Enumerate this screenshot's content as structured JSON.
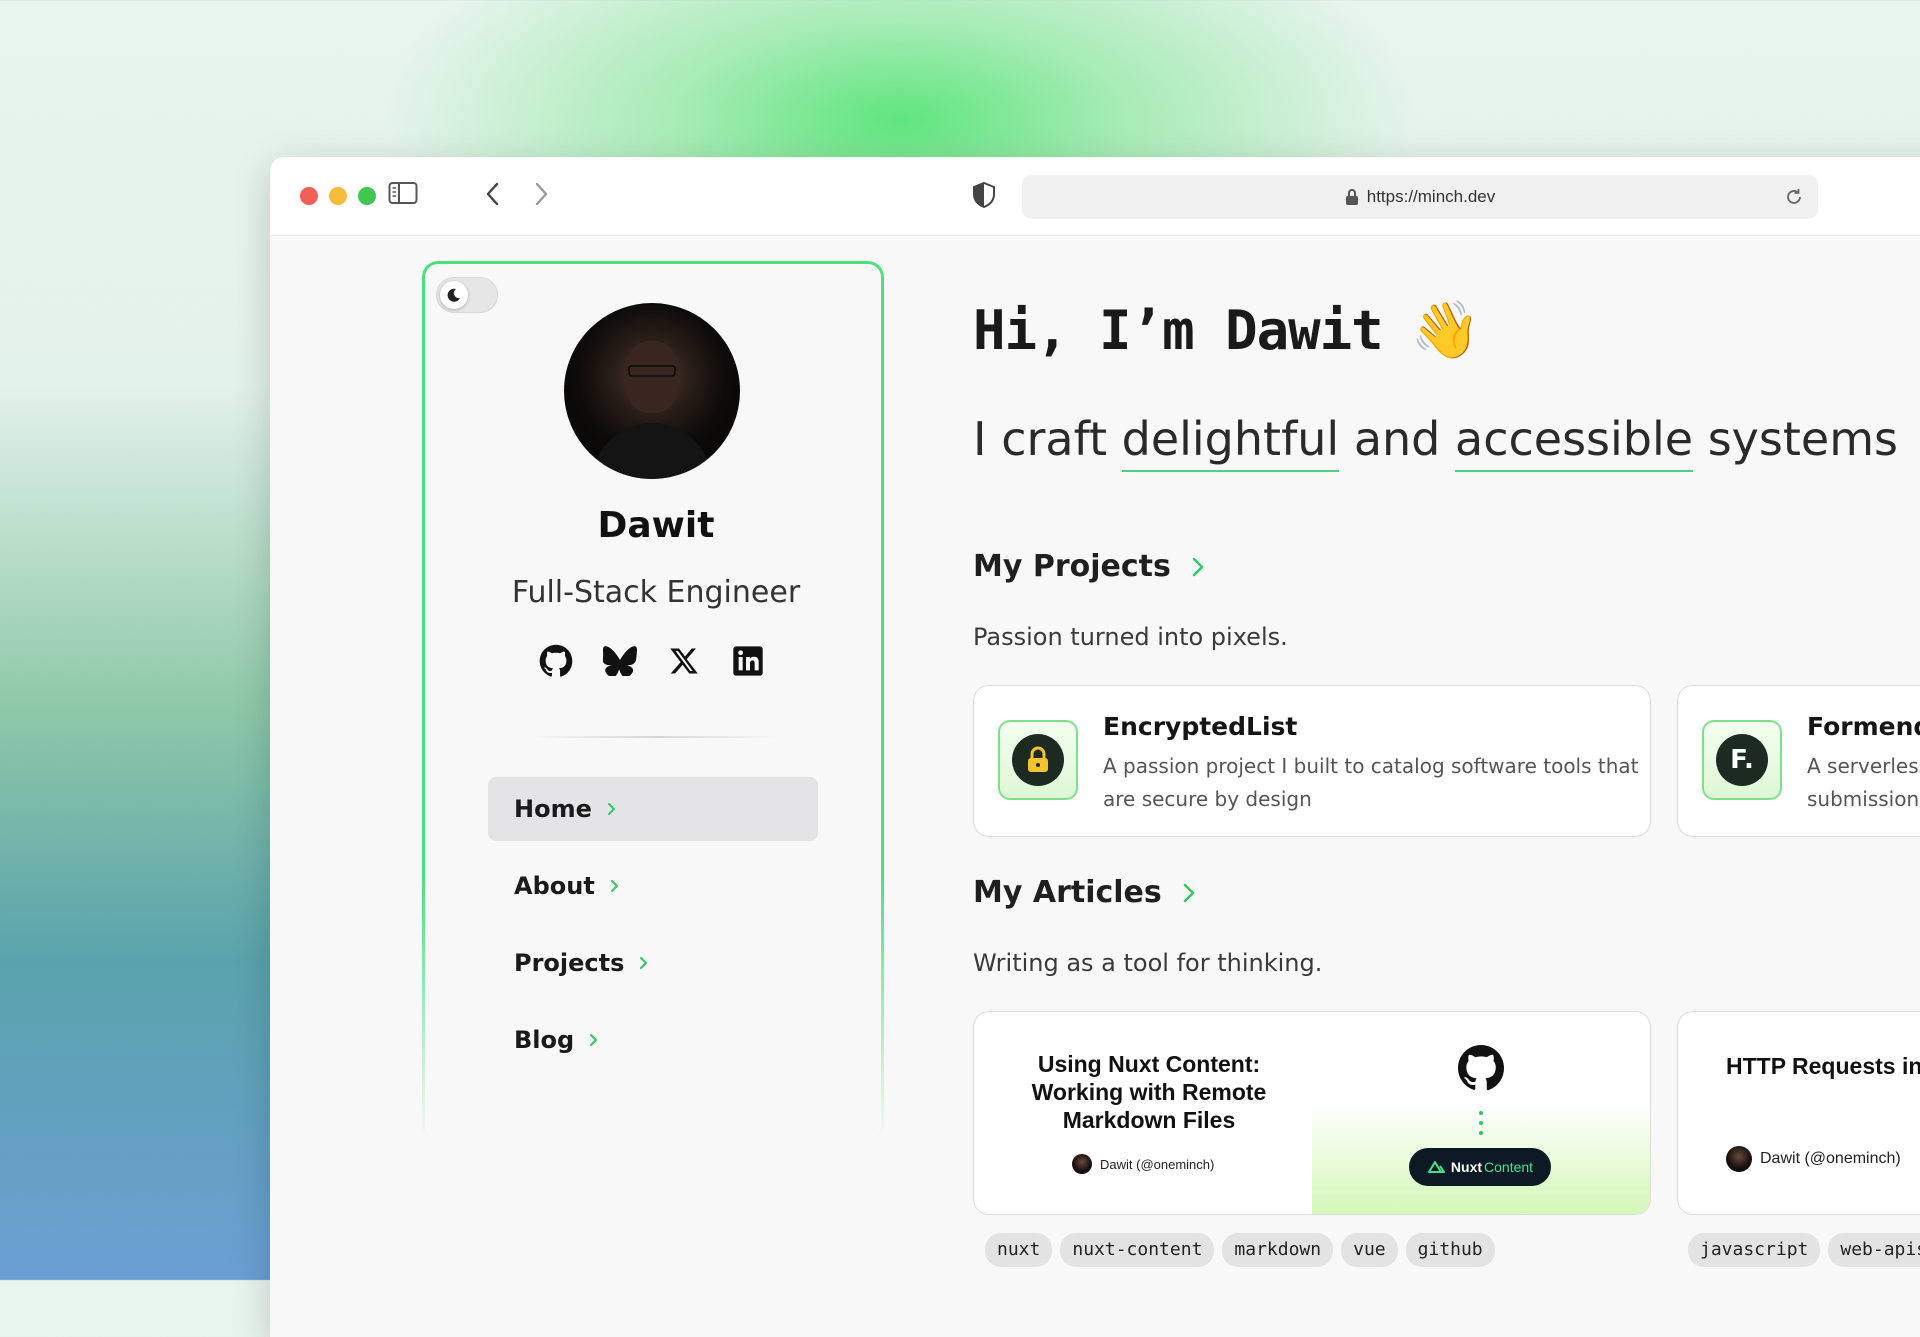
{
  "browser": {
    "url": "https://minch.dev"
  },
  "sidebar": {
    "name": "Dawit",
    "role": "Full-Stack Engineer",
    "socials": [
      "github-icon",
      "bluesky-icon",
      "x-icon",
      "linkedin-icon"
    ],
    "nav": [
      {
        "label": "Home",
        "active": true
      },
      {
        "label": "About",
        "active": false
      },
      {
        "label": "Projects",
        "active": false
      },
      {
        "label": "Blog",
        "active": false
      }
    ]
  },
  "hero": {
    "greeting": "Hi, I’m Dawit",
    "wave": "👋",
    "tagline_start": "I craft ",
    "tagline_hl1": "delightful",
    "tagline_mid": " and ",
    "tagline_hl2": "accessible",
    "tagline_end": " systems"
  },
  "projects": {
    "title": "My Projects",
    "subtitle": "Passion turned into pixels.",
    "items": [
      {
        "name": "EncryptedList",
        "description": "A passion project I built to catalog software tools that are secure by design",
        "logo": "lock-icon"
      },
      {
        "name": "Formend",
        "description": "A serverless submission",
        "logo_letter": "F."
      }
    ]
  },
  "articles": {
    "title": "My Articles",
    "subtitle": "Writing as a tool for thinking.",
    "items": [
      {
        "title": "Using Nuxt Content: Working with Remote Markdown Files",
        "author": "Dawit (@oneminch)",
        "badge_a": "Nuxt",
        "badge_b": "Content",
        "tags": [
          "nuxt",
          "nuxt-content",
          "markdown",
          "vue",
          "github"
        ]
      },
      {
        "title": "HTTP Requests in JavaScript",
        "author": "Dawit (@oneminch)",
        "tags": [
          "javascript",
          "web-apis"
        ]
      }
    ]
  },
  "colors": {
    "accent": "#3ddc6d",
    "nav_active_bg": "#e4e4e6"
  }
}
